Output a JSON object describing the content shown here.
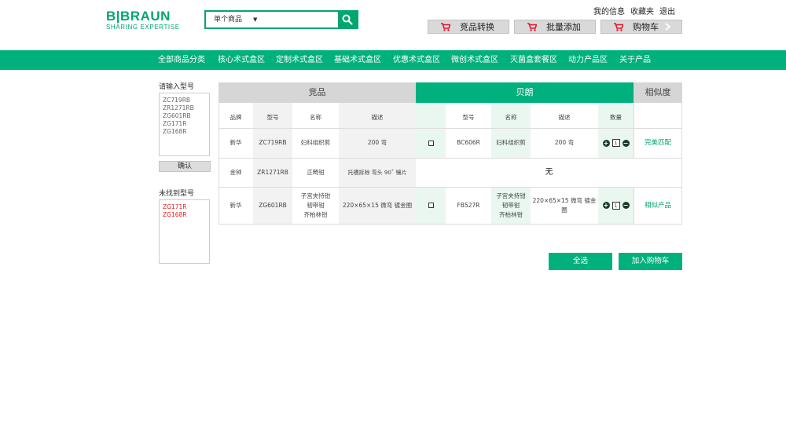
{
  "logo": {
    "brand": "B|BRAUN",
    "tagline": "SHARING EXPERTISE"
  },
  "search": {
    "mode": "单个商品",
    "caret": "▼"
  },
  "top_links": [
    "我的信息",
    "收藏夹",
    "退出"
  ],
  "actions": {
    "compare": "竞品转换",
    "batch_add": "批量添加",
    "cart": "购物车"
  },
  "nav": [
    "全部商品分类",
    "核心术式盒区",
    "定制术式盒区",
    "基础术式盒区",
    "优惠术式盒区",
    "微创术式盒区",
    "灭菌盒套餐区",
    "动力产品区",
    "关于产品"
  ],
  "sidebar": {
    "input_label": "请输入型号",
    "input_lines": [
      "ZC719RB",
      "ZR1271RB",
      "ZG601RB",
      "ZG171R",
      "ZG168R"
    ],
    "confirm": "确认",
    "notfound_label": "未找到型号",
    "notfound_lines": [
      "ZG171R",
      "ZG168R"
    ]
  },
  "table": {
    "group_competitor": "竞品",
    "group_braun": "贝朗",
    "group_similarity": "相似度",
    "col_competitor": [
      "品牌",
      "型号",
      "名称",
      "描述"
    ],
    "col_braun": [
      "型号",
      "名称",
      "描述",
      "数量"
    ],
    "rows": [
      {
        "brand": "新华",
        "model": "ZC719RB",
        "name": "妇科组织剪",
        "desc": "200 弯",
        "b_model": "BC606R",
        "b_name": "妇科组织剪",
        "b_desc": "200 弯",
        "qty": "1",
        "similarity": "完美匹配"
      },
      {
        "brand": "金钟",
        "model": "ZR1271RB",
        "name": "正畸钳",
        "desc": "托槽拆除 弯头 90˚ 镶片",
        "none": "无"
      },
      {
        "brand": "新华",
        "model": "ZG601RB",
        "name": "子宫夹持钳\n韧带钳\n齐柏林钳",
        "desc": "220×65×15 微弯 镀金圈",
        "b_model": "FB527R",
        "b_name": "子宫夹持钳\n韧带钳\n齐柏林钳",
        "b_desc": "220×65×15 微弯 镀金圈",
        "qty": "1",
        "similarity": "相似产品"
      }
    ]
  },
  "buttons": {
    "select_all": "全选",
    "add_to_cart": "加入购物车"
  },
  "colors": {
    "accent": "#00b07d",
    "brand_green": "#00a670",
    "error_red": "#e02020"
  }
}
